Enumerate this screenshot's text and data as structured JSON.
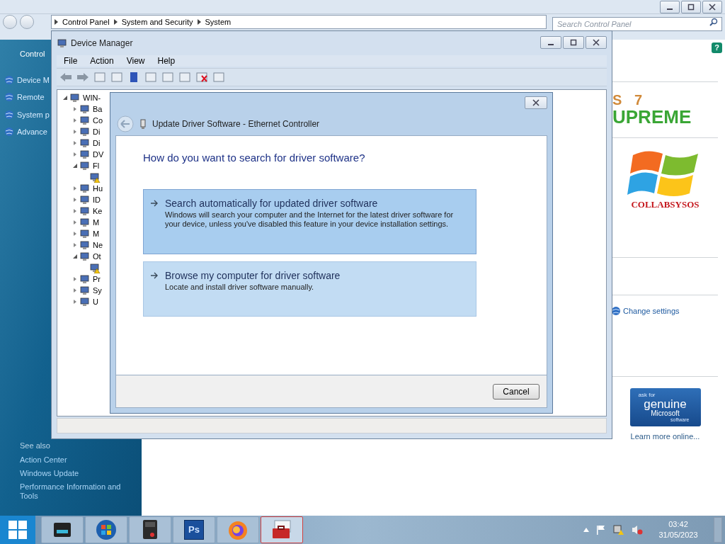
{
  "control_panel": {
    "breadcrumb": [
      "Control Panel",
      "System and Security",
      "System"
    ],
    "search": {
      "placeholder": "Search Control Panel"
    },
    "nav": {
      "home": "Control",
      "links": [
        "Device M",
        "Remote",
        "System p",
        "Advance"
      ],
      "see_also_title": "See also",
      "see_also": [
        "Action Center",
        "Windows Update",
        "Performance Information and Tools"
      ]
    },
    "logo": {
      "line_1": "S 7",
      "line_2": "UPREME",
      "brand": "COLLABSYSOS"
    },
    "help": "?",
    "change_settings": "Change settings",
    "genuine": {
      "line_1": "ask for",
      "line_2": "genuine",
      "line_3": "Microsoft",
      "line_4": "software"
    },
    "learn_more": "Learn more online..."
  },
  "device_manager": {
    "title": "Device Manager",
    "menu": [
      "File",
      "Action",
      "View",
      "Help"
    ],
    "tree": {
      "label": "WIN-",
      "expanded": true,
      "children": [
        {
          "label": "Ba",
          "expanded": false
        },
        {
          "label": "Co",
          "expanded": false
        },
        {
          "label": "Di",
          "expanded": false
        },
        {
          "label": "Di",
          "expanded": false
        },
        {
          "label": "DV",
          "expanded": false
        },
        {
          "label": "Fl",
          "expanded": true,
          "children": [
            {
              "warning": true
            }
          ]
        },
        {
          "label": "Hu",
          "expanded": false
        },
        {
          "label": "ID",
          "expanded": false
        },
        {
          "label": "Ke",
          "expanded": false
        },
        {
          "label": "M",
          "expanded": false
        },
        {
          "label": "M",
          "expanded": false
        },
        {
          "label": "Ne",
          "expanded": false
        },
        {
          "label": "Ot",
          "expanded": true,
          "children": [
            {
              "warning": true
            }
          ]
        },
        {
          "label": "Pr",
          "expanded": false
        },
        {
          "label": "Sy",
          "expanded": false
        },
        {
          "label": "U",
          "expanded": false
        }
      ]
    }
  },
  "dialog": {
    "title": "Update Driver Software - Ethernet Controller",
    "heading": "How do you want to search for driver software?",
    "options": [
      {
        "title": "Search automatically for updated driver software",
        "description": "Windows will search your computer and the Internet for the latest driver software for your device, unless you've disabled this feature in your device installation settings.",
        "selected": true
      },
      {
        "title": "Browse my computer for driver software",
        "description": "Locate and install driver software manually.",
        "selected": false
      }
    ],
    "cancel": "Cancel"
  },
  "taskbar": {
    "apps": [
      {
        "kind": "files",
        "selected": false
      },
      {
        "kind": "windows",
        "selected": false
      },
      {
        "kind": "calculator",
        "selected": false
      },
      {
        "kind": "photoshop",
        "label": "Ps",
        "selected": false
      },
      {
        "kind": "firefox",
        "selected": false
      },
      {
        "kind": "toolbox",
        "selected": true
      }
    ],
    "time": "03:42",
    "date": "31/05/2023"
  }
}
